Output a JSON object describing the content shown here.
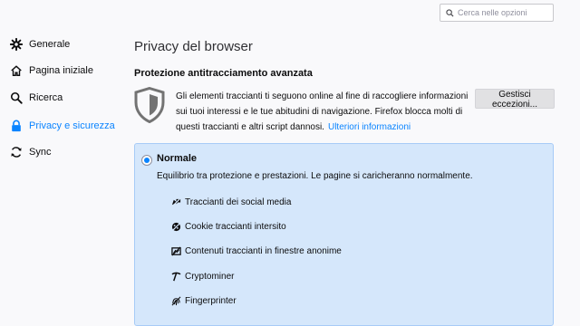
{
  "search": {
    "placeholder": "Cerca nelle opzioni",
    "icon": "search-icon"
  },
  "sidebar": {
    "items": [
      {
        "label": "Generale",
        "icon": "gear-icon",
        "active": false
      },
      {
        "label": "Pagina iniziale",
        "icon": "home-icon",
        "active": false
      },
      {
        "label": "Ricerca",
        "icon": "search-icon",
        "active": false
      },
      {
        "label": "Privacy e sicurezza",
        "icon": "lock-icon",
        "active": true
      },
      {
        "label": "Sync",
        "icon": "sync-icon",
        "active": false
      }
    ]
  },
  "main": {
    "title": "Privacy del browser",
    "section_title": "Protezione antitracciamento avanzata",
    "description": "Gli elementi traccianti ti seguono online al fine di raccogliere informazioni sui tuoi interessi e le tue abitudini di navigazione. Firefox blocca molti di questi traccianti e altri script dannosi.",
    "learn_more": "Ulteriori informazioni",
    "manage_button": "Gestisci eccezioni..."
  },
  "standard": {
    "label": "Normale",
    "selected": true,
    "description": "Equilibrio tra protezione e prestazioni. Le pagine si caricheranno normalmente.",
    "trackers": [
      {
        "label": "Traccianti dei social media",
        "icon": "social-tracker-icon"
      },
      {
        "label": "Cookie traccianti intersito",
        "icon": "cookie-icon"
      },
      {
        "label": "Contenuti traccianti in finestre anonime",
        "icon": "tracking-content-icon"
      },
      {
        "label": "Cryptominer",
        "icon": "cryptominer-icon"
      },
      {
        "label": "Fingerprinter",
        "icon": "fingerprinter-icon"
      }
    ]
  },
  "colors": {
    "accent": "#0a84ff",
    "panel_bg": "#d5e7fb",
    "panel_border": "#a7cbf7",
    "background": "#f9f9fb"
  }
}
